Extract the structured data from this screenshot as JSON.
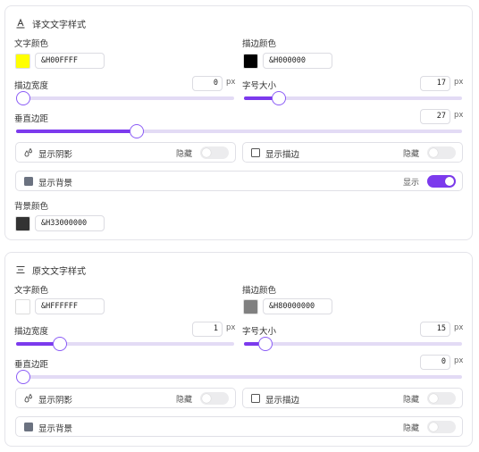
{
  "translation_panel": {
    "title": "译文文字样式",
    "text_color": {
      "label": "文字颜色",
      "value": "&H00FFFF",
      "color": "#ffff00"
    },
    "outline_color": {
      "label": "描边颜色",
      "value": "&H000000",
      "color": "#000000"
    },
    "outline_width": {
      "label": "描边宽度",
      "value": "0",
      "unit": "px",
      "fraction": 0.0
    },
    "font_size": {
      "label": "字号大小",
      "value": "17",
      "unit": "px",
      "fraction": 0.16
    },
    "vertical_margin": {
      "label": "垂直边距",
      "value": "27",
      "unit": "px",
      "fraction": 0.27
    },
    "shadow": {
      "label": "显示阴影",
      "state": "隐藏",
      "on": false
    },
    "outline": {
      "label": "显示描边",
      "state": "隐藏",
      "on": false
    },
    "background": {
      "label": "显示背景",
      "state": "显示",
      "on": true
    },
    "bg_color": {
      "label": "背景颜色",
      "value": "&H33000000",
      "color": "#333333"
    }
  },
  "original_panel": {
    "title": "原文文字样式",
    "text_color": {
      "label": "文字颜色",
      "value": "&HFFFFFF",
      "color": "#ffffff"
    },
    "outline_color": {
      "label": "描边颜色",
      "value": "&H80000000",
      "color": "#808080"
    },
    "outline_width": {
      "label": "描边宽度",
      "value": "1",
      "unit": "px",
      "fraction": 0.2
    },
    "font_size": {
      "label": "字号大小",
      "value": "15",
      "unit": "px",
      "fraction": 0.1
    },
    "vertical_margin": {
      "label": "垂直边距",
      "value": "0",
      "unit": "px",
      "fraction": 0.0
    },
    "shadow": {
      "label": "显示阴影",
      "state": "隐藏",
      "on": false
    },
    "outline": {
      "label": "显示描边",
      "state": "隐藏",
      "on": false
    },
    "background": {
      "label": "显示背景",
      "state": "隐藏",
      "on": false
    }
  },
  "accent_color": "#7c3aed"
}
